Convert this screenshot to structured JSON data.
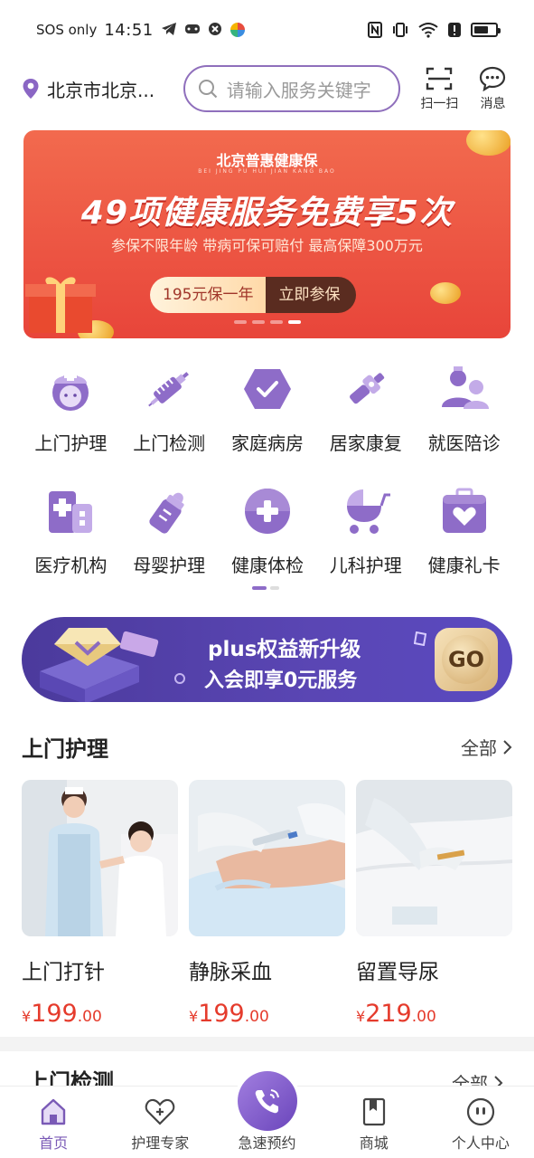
{
  "status_bar": {
    "carrier": "SOS only",
    "time": "14:51",
    "battery_level": 0.7
  },
  "header": {
    "location": "北京市北京...",
    "search_placeholder": "请输入服务关键字",
    "scan_label": "扫一扫",
    "message_label": "消息"
  },
  "banner": {
    "brand": "北京普惠健康保",
    "brand_pinyin": "BEI JING PU HUI JIAN KANG BAO",
    "title": "49项健康服务免费享5次",
    "subtitle": "参保不限年龄 带病可保可赔付 最高保障300万元",
    "cta_price": "195元保一年",
    "cta_action": "立即参保",
    "slides": 4,
    "active_slide": 4
  },
  "services": [
    {
      "label": "上门护理",
      "icon": "nurse-icon"
    },
    {
      "label": "上门检测",
      "icon": "syringe-icon"
    },
    {
      "label": "家庭病房",
      "icon": "shield-check-icon"
    },
    {
      "label": "居家康复",
      "icon": "rehab-icon"
    },
    {
      "label": "就医陪诊",
      "icon": "escort-icon"
    },
    {
      "label": "医疗机构",
      "icon": "hospital-icon"
    },
    {
      "label": "母婴护理",
      "icon": "baby-bottle-icon"
    },
    {
      "label": "健康体检",
      "icon": "plus-badge-icon"
    },
    {
      "label": "儿科护理",
      "icon": "stroller-icon"
    },
    {
      "label": "健康礼卡",
      "icon": "gift-card-icon"
    }
  ],
  "plus_banner": {
    "line1": "plus权益新升级",
    "line2": "入会即享0元服务",
    "go": "GO"
  },
  "section_home_care": {
    "title": "上门护理",
    "all": "全部",
    "items": [
      {
        "name": "上门打针",
        "currency": "¥",
        "price_int": "199",
        "price_dec": ".00"
      },
      {
        "name": "静脉采血",
        "currency": "¥",
        "price_int": "199",
        "price_dec": ".00"
      },
      {
        "name": "留置导尿",
        "currency": "¥",
        "price_int": "219",
        "price_dec": ".00"
      }
    ]
  },
  "section_home_test": {
    "title": "上门检测",
    "all": "全部"
  },
  "bottom_nav": {
    "home": "首页",
    "experts": "护理专家",
    "quick_booking": "急速预约",
    "mall": "商城",
    "profile": "个人中心"
  },
  "colors": {
    "brand_purple": "#7a5ab6",
    "price_red": "#e53b2c",
    "banner_red": "#e8453a",
    "plus_blue": "#4b3a9c"
  }
}
